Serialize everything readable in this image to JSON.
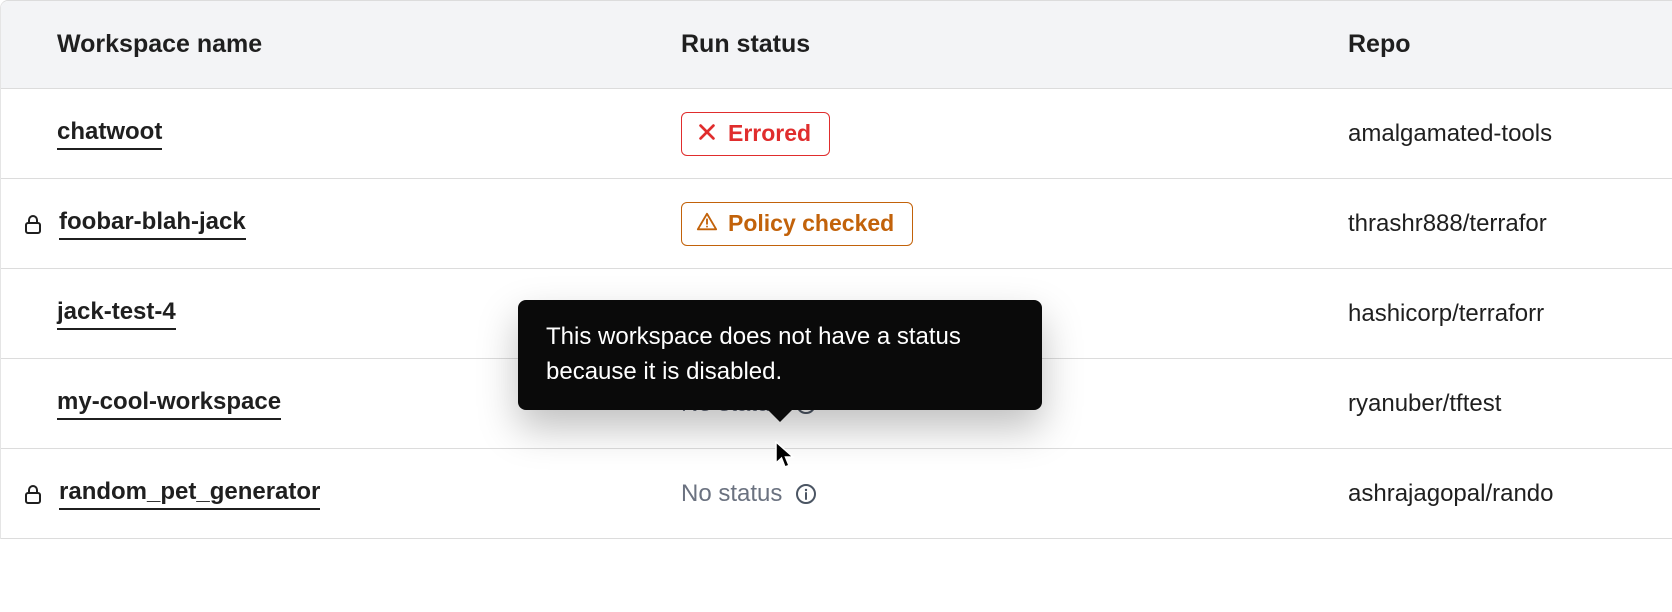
{
  "columns": {
    "workspace": "Workspace name",
    "run_status": "Run status",
    "repo": "Repo"
  },
  "tooltip": {
    "text": "This workspace does not have a status because it is disabled."
  },
  "status": {
    "errored": "Errored",
    "policy_checked": "Policy checked",
    "no_status": "No status"
  },
  "rows": [
    {
      "name": "chatwoot",
      "locked": false,
      "status_type": "errored",
      "repo": "amalgamated-tools"
    },
    {
      "name": "foobar-blah-jack",
      "locked": true,
      "status_type": "policy_checked",
      "repo": "thrashr888/terrafor"
    },
    {
      "name": "jack-test-4",
      "locked": false,
      "status_type": "none",
      "repo": "hashicorp/terraforr"
    },
    {
      "name": "my-cool-workspace",
      "locked": false,
      "status_type": "no_status",
      "repo": "ryanuber/tftest"
    },
    {
      "name": "random_pet_generator",
      "locked": true,
      "status_type": "no_status",
      "repo": "ashrajagopal/rando"
    }
  ],
  "colors": {
    "error": "#e02d2d",
    "warn": "#c2620a",
    "muted": "#6b7280"
  }
}
